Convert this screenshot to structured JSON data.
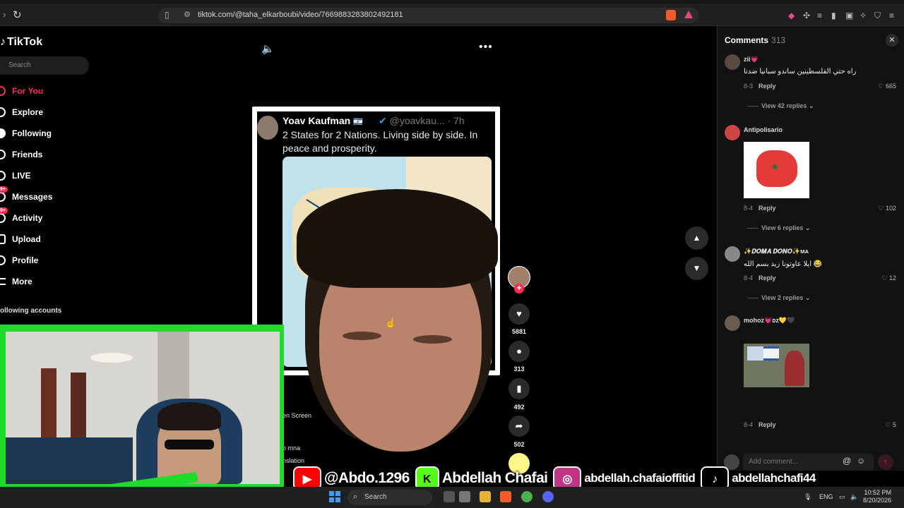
{
  "browser": {
    "url": "tiktok.com/@taha_elkarboubi/video/7669883283802492181"
  },
  "sidebar": {
    "logo": "TikTok",
    "search_placeholder": "Search",
    "items": [
      {
        "label": "For You",
        "active": true,
        "icon": "home-icon"
      },
      {
        "label": "Explore",
        "icon": "compass-icon"
      },
      {
        "label": "Following",
        "icon": "following-icon"
      },
      {
        "label": "Friends",
        "icon": "friends-icon"
      },
      {
        "label": "LIVE",
        "icon": "live-icon"
      },
      {
        "label": "Messages",
        "icon": "messages-icon"
      },
      {
        "label": "Activity",
        "icon": "activity-icon"
      },
      {
        "label": "Upload",
        "icon": "upload-icon"
      },
      {
        "label": "Profile",
        "icon": "profile-icon"
      },
      {
        "label": "More",
        "icon": "more-icon"
      }
    ],
    "following_accounts": "ollowing accounts"
  },
  "tweet": {
    "name": "Yoav Kaufman",
    "handle": "@yoavkau... · 7h",
    "body": "2 States for 2 Nations. Living side by side. In peace and prosperity."
  },
  "video_overlay": {
    "screen_text": "en Screen",
    "caption": "o mna",
    "translation": "nslation"
  },
  "actions": {
    "likes": "5881",
    "comments": "313",
    "saves": "492",
    "shares": "502"
  },
  "comments": {
    "title": "Comments",
    "count": "313",
    "add_placeholder": "Add comment...",
    "items": [
      {
        "user": "zii💗",
        "text": "راه حتي الفلسطينين ساندو سبانيا ضدنا",
        "date": "8-3",
        "reply": "Reply",
        "likes": "665",
        "view_replies": "View 42 replies"
      },
      {
        "user": "Antipolisario",
        "text": "",
        "date": "8-4",
        "reply": "Reply",
        "likes": "102",
        "view_replies": "View 6 replies"
      },
      {
        "user": "✨𝑫𝑶𝑴𝑨 𝑫𝑶𝑵𝑶✨ᴍᴀ",
        "text": "ايلا عاوتونا زيد بسم الله 😂",
        "date": "8-4",
        "reply": "Reply",
        "likes": "12",
        "view_replies": "View 2 replies"
      },
      {
        "user": "mohᴏᴢ💗ᴅᴢ💛🖤",
        "text": "",
        "date": "8-4",
        "reply": "Reply",
        "likes": "5"
      }
    ]
  },
  "social": {
    "youtube": "@Abdo.1296",
    "kick": "Abdellah Chafai",
    "instagram": "abdellah.chafaioffitid",
    "tiktok": "abdellahchafi44"
  },
  "taskbar": {
    "search": "Search",
    "lang": "ENG",
    "time": "10:52 PM",
    "date": "8/20/2026"
  }
}
